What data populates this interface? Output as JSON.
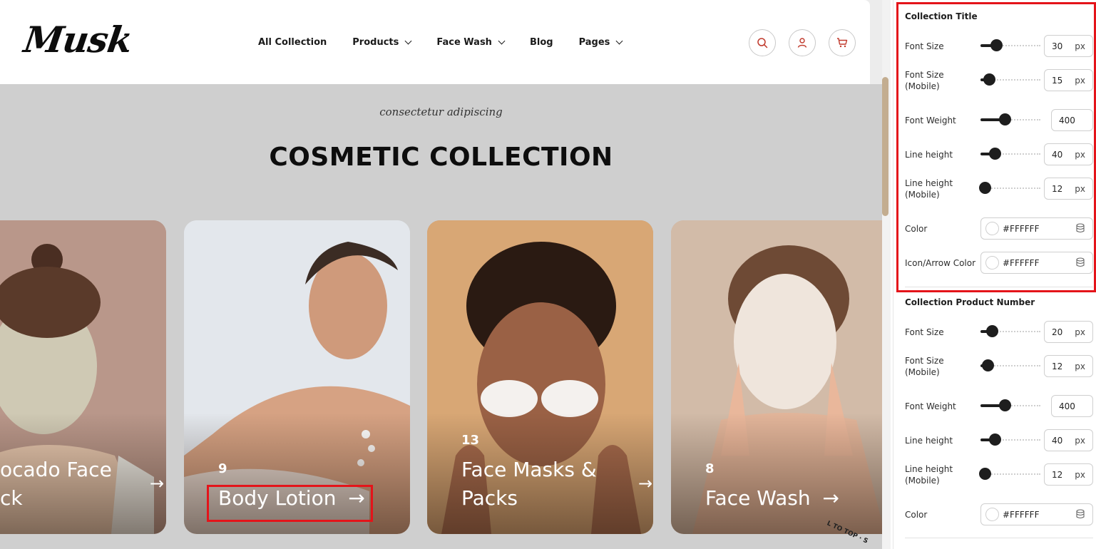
{
  "header": {
    "logo": "Musk",
    "nav": [
      {
        "label": "All Collection",
        "has_dropdown": false
      },
      {
        "label": "Products",
        "has_dropdown": true
      },
      {
        "label": "Face Wash",
        "has_dropdown": true
      },
      {
        "label": "Blog",
        "has_dropdown": false
      },
      {
        "label": "Pages",
        "has_dropdown": true
      }
    ],
    "icons": [
      "search-icon",
      "user-icon",
      "cart-icon"
    ]
  },
  "hero": {
    "subtitle": "consectetur adipiscing",
    "title": "COSMETIC COLLECTION"
  },
  "cards": [
    {
      "number": "",
      "title_line1": "ocado Face",
      "title_line2": "ck",
      "bg": "#b9978a"
    },
    {
      "number": "9",
      "title_line1": "Body Lotion",
      "title_line2": "",
      "bg": "#dfe4ea"
    },
    {
      "number": "13",
      "title_line1": "Face Masks &",
      "title_line2": "Packs",
      "bg": "#c8956a"
    },
    {
      "number": "8",
      "title_line1": "Face Wash",
      "title_line2": "",
      "bg": "#c7ac98"
    }
  ],
  "arrow": "→",
  "scroll_to_top": "L TO TOP · S",
  "panel": {
    "collection_title": {
      "heading": "Collection Title",
      "rows": [
        {
          "label": "Font Size",
          "value": "30",
          "unit": "px"
        },
        {
          "label": "Font Size\n(Mobile)",
          "value": "15",
          "unit": "px"
        },
        {
          "label": "Font Weight",
          "value": "400",
          "unit": ""
        },
        {
          "label": "Line height",
          "value": "40",
          "unit": "px"
        },
        {
          "label": "Line height\n(Mobile)",
          "value": "12",
          "unit": "px"
        }
      ],
      "color_label": "Color",
      "color_value": "#FFFFFF",
      "icon_color_label": "Icon/Arrow Color",
      "icon_color_value": "#FFFFFF"
    },
    "product_number": {
      "heading": "Collection Product Number",
      "rows": [
        {
          "label": "Font Size",
          "value": "20",
          "unit": "px"
        },
        {
          "label": "Font Size\n(Mobile)",
          "value": "12",
          "unit": "px"
        },
        {
          "label": "Font Weight",
          "value": "400",
          "unit": ""
        },
        {
          "label": "Line height",
          "value": "40",
          "unit": "px"
        },
        {
          "label": "Line height\n(Mobile)",
          "value": "12",
          "unit": "px"
        }
      ],
      "color_label": "Color",
      "color_value": "#FFFFFF"
    }
  },
  "colors": {
    "accent_red": "#e4141a",
    "icon_red": "#c0392b",
    "scroll_thumb": "#c3ad90"
  }
}
